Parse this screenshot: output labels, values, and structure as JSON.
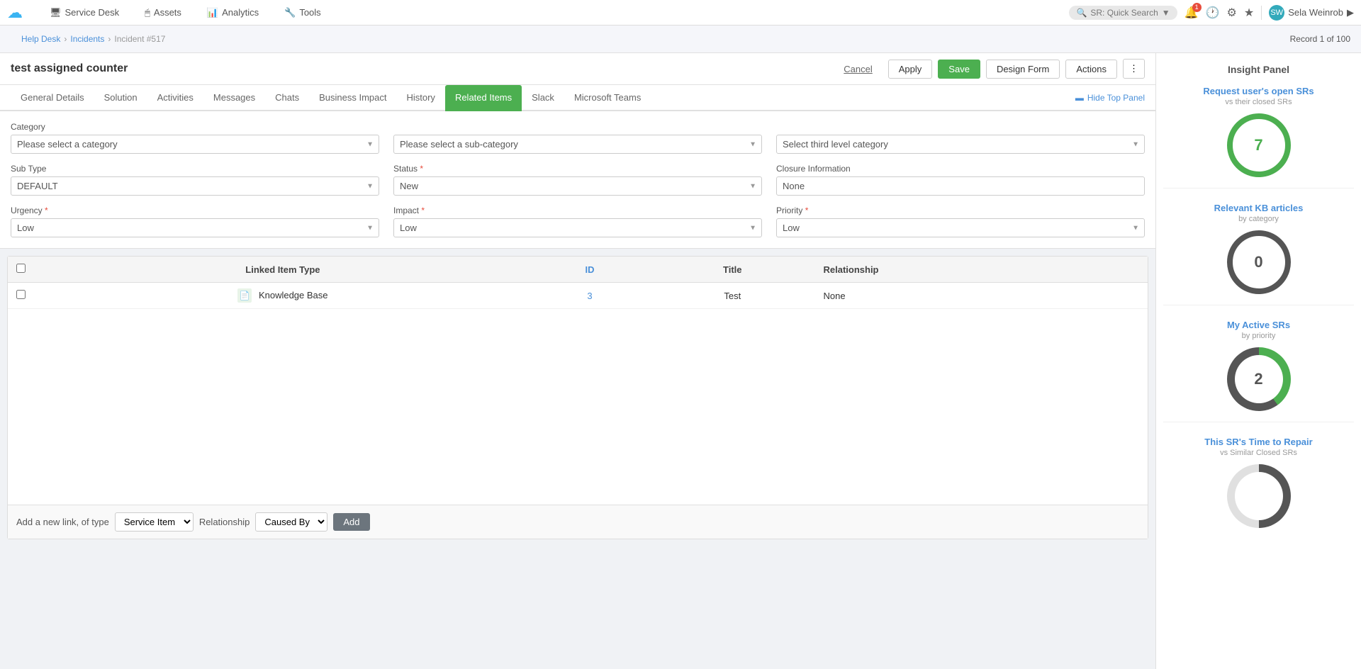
{
  "topNav": {
    "logo": "☁",
    "items": [
      {
        "id": "service-desk",
        "icon": "🖥",
        "label": "Service Desk"
      },
      {
        "id": "assets",
        "icon": "🖱",
        "label": "Assets"
      },
      {
        "id": "analytics",
        "icon": "📊",
        "label": "Analytics"
      },
      {
        "id": "tools",
        "icon": "🔧",
        "label": "Tools"
      }
    ],
    "search": {
      "placeholder": "SR: Quick Search"
    },
    "notificationCount": "1",
    "user": "Sela Weinrob"
  },
  "breadcrumb": {
    "help_desk": "Help Desk",
    "incidents": "Incidents",
    "current": "Incident #517",
    "record_info": "Record 1 of 100"
  },
  "titleBar": {
    "title": "test assigned counter",
    "cancel_label": "Cancel",
    "apply_label": "Apply",
    "save_label": "Save",
    "design_label": "Design Form",
    "actions_label": "Actions"
  },
  "tabs": [
    {
      "id": "general-details",
      "label": "General Details"
    },
    {
      "id": "solution",
      "label": "Solution"
    },
    {
      "id": "activities",
      "label": "Activities"
    },
    {
      "id": "messages",
      "label": "Messages"
    },
    {
      "id": "chats",
      "label": "Chats"
    },
    {
      "id": "business-impact",
      "label": "Business Impact"
    },
    {
      "id": "history",
      "label": "History"
    },
    {
      "id": "related-items",
      "label": "Related Items",
      "active": true
    },
    {
      "id": "slack",
      "label": "Slack"
    },
    {
      "id": "microsoft-teams",
      "label": "Microsoft Teams"
    }
  ],
  "hideTopPanel": "Hide Top Panel",
  "form": {
    "category_label": "Category",
    "category_placeholder": "Please select a category",
    "subcategory_placeholder": "Please select a sub-category",
    "third_level_placeholder": "Select third level category",
    "subtype_label": "Sub Type",
    "subtype_value": "DEFAULT",
    "status_label": "Status",
    "status_required": true,
    "status_value": "New",
    "closure_label": "Closure Information",
    "closure_value": "None",
    "urgency_label": "Urgency",
    "urgency_required": true,
    "urgency_value": "Low",
    "impact_label": "Impact",
    "impact_required": true,
    "impact_value": "Low",
    "priority_label": "Priority",
    "priority_required": true,
    "priority_value": "Low"
  },
  "table": {
    "columns": [
      {
        "id": "check",
        "label": ""
      },
      {
        "id": "linked-item-type",
        "label": "Linked Item Type"
      },
      {
        "id": "id",
        "label": "ID"
      },
      {
        "id": "title",
        "label": "Title"
      },
      {
        "id": "relationship",
        "label": "Relationship"
      }
    ],
    "rows": [
      {
        "type": "Knowledge Base",
        "id": "3",
        "title": "Test",
        "relationship": "None"
      }
    ]
  },
  "addLink": {
    "label": "Add a new link, of type",
    "type_value": "Service Item",
    "relationship_label": "Relationship",
    "relationship_value": "Caused By",
    "add_btn": "Add"
  },
  "insightPanel": {
    "title": "Insight Panel",
    "cards": [
      {
        "id": "open-srs",
        "title": "Request user's open SRs",
        "subtitle": "vs their closed SRs",
        "value": "7",
        "color": "green"
      },
      {
        "id": "kb-articles",
        "title": "Relevant KB articles",
        "subtitle": "by category",
        "value": "0",
        "color": "gray"
      },
      {
        "id": "active-srs",
        "title": "My Active SRs",
        "subtitle": "by priority",
        "value": "2",
        "color": "partial"
      },
      {
        "id": "time-to-repair",
        "title": "This SR's Time to Repair",
        "subtitle": "vs Similar Closed SRs",
        "value": "",
        "color": "half"
      }
    ]
  }
}
